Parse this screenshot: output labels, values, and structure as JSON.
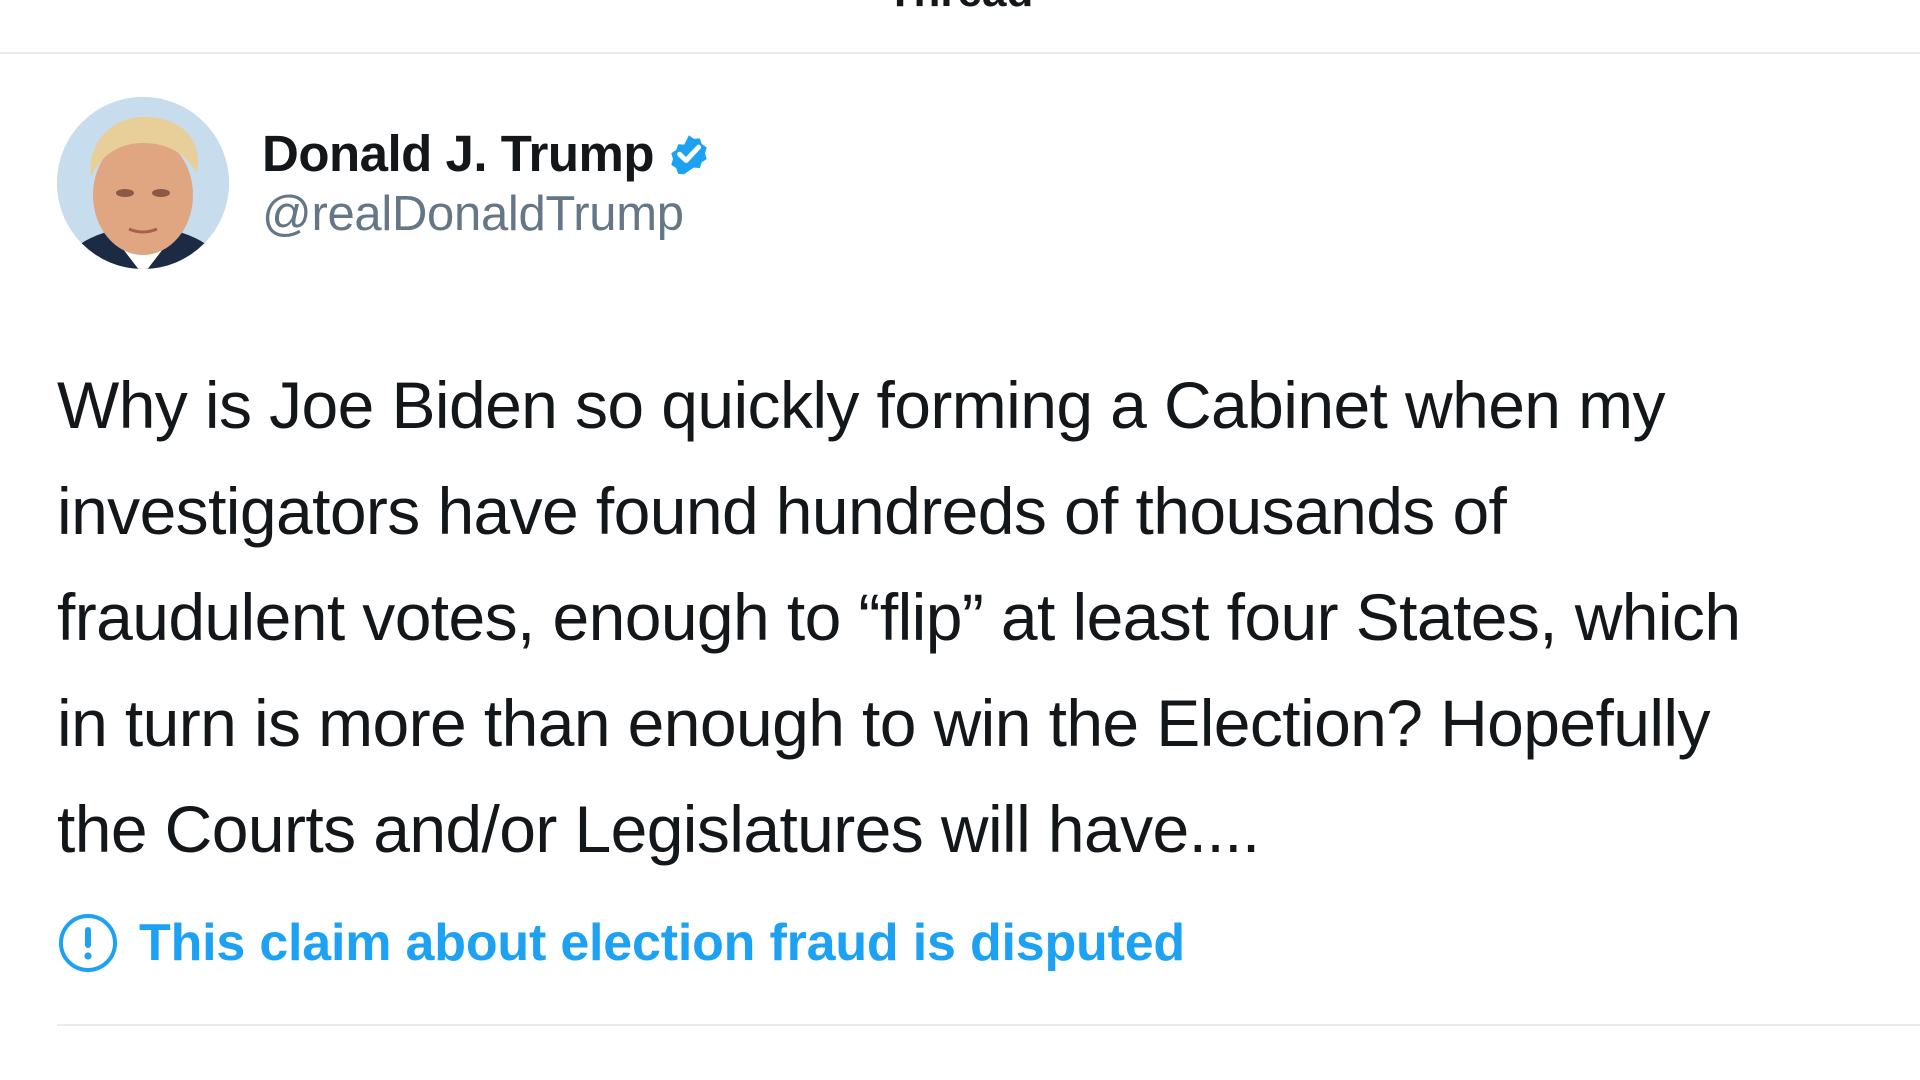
{
  "header": {
    "title": "Thread"
  },
  "tweet": {
    "author_name": "Donald J. Trump",
    "handle": "@realDonaldTrump",
    "verified_icon": "verified-badge-icon",
    "text_lines": [
      "Why is Joe Biden so quickly forming a Cabinet when my",
      "investigators have found hundreds of thousands of",
      "fraudulent votes, enough to “flip” at least four States, which",
      "in turn is more than enough to win the Election? Hopefully",
      "the Courts and/or Legislatures will have...."
    ],
    "notice": {
      "icon": "exclamation-circle-icon",
      "label": "This claim about election fraud is disputed"
    }
  },
  "colors": {
    "accent": "#1da1f2",
    "text": "#14171a",
    "secondary_text": "#657786",
    "divider": "#e6ecf0"
  }
}
